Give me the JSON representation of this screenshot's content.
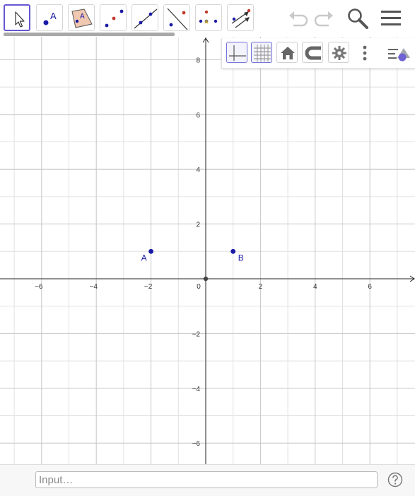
{
  "app": {
    "accent_color": "#6557d2",
    "point_color": "#1a1aa6"
  },
  "toolbar": {
    "tools": [
      {
        "name": "move-tool",
        "icon": "cursor-arrow-icon",
        "active": true,
        "label": ""
      },
      {
        "name": "point-tool",
        "icon": "point-icon",
        "active": false,
        "label": "A"
      },
      {
        "name": "polygon-tool",
        "icon": "polygon-icon",
        "active": false,
        "label": "A"
      },
      {
        "name": "two-points-tool",
        "icon": "two-points-icon",
        "active": false,
        "label": ""
      },
      {
        "name": "line-tool",
        "icon": "line-icon",
        "active": false,
        "label": ""
      },
      {
        "name": "perpendicular-line-tool",
        "icon": "perpendicular-line-icon",
        "active": false,
        "label": ""
      },
      {
        "name": "angle-tool",
        "icon": "angle-icon",
        "active": false,
        "label": ""
      },
      {
        "name": "vector-tool",
        "icon": "vector-icon",
        "active": false,
        "label": ""
      }
    ],
    "right_icons": [
      "undo-icon",
      "redo-icon",
      "search-icon",
      "hamburger-menu-icon"
    ]
  },
  "stylebar": {
    "buttons": [
      {
        "name": "toggle-axes-button",
        "icon": "axes-icon",
        "selected": true
      },
      {
        "name": "toggle-grid-button",
        "icon": "grid-icon",
        "selected": true
      },
      {
        "name": "standard-view-button",
        "icon": "home-icon",
        "selected": false
      },
      {
        "name": "point-capturing-button",
        "icon": "magnet-icon",
        "selected": false
      },
      {
        "name": "graphics-settings-button",
        "icon": "gear-icon",
        "selected": false
      },
      {
        "name": "more-options-button",
        "icon": "vertical-dots-icon",
        "selected": false
      },
      {
        "name": "algebra-toggle-button",
        "icon": "algebra-view-icon",
        "selected": false
      }
    ]
  },
  "graphics": {
    "x_ticks": [
      -6,
      -4,
      -2,
      0,
      2,
      4,
      6
    ],
    "y_ticks": [
      8,
      6,
      4,
      2,
      -2,
      -4,
      -6
    ],
    "x_range": [
      -7.5,
      7.5
    ],
    "y_range": [
      -6.8,
      8.8
    ],
    "grid": true,
    "points": [
      {
        "name": "A",
        "x": -2,
        "y": 1,
        "label": "A"
      },
      {
        "name": "B",
        "x": 1,
        "y": 1,
        "label": "B"
      },
      {
        "name": "origin",
        "x": 0,
        "y": 0,
        "label": ""
      }
    ]
  },
  "inputbar": {
    "placeholder": "Input…",
    "value": "",
    "help_icon": "question-mark-icon"
  }
}
